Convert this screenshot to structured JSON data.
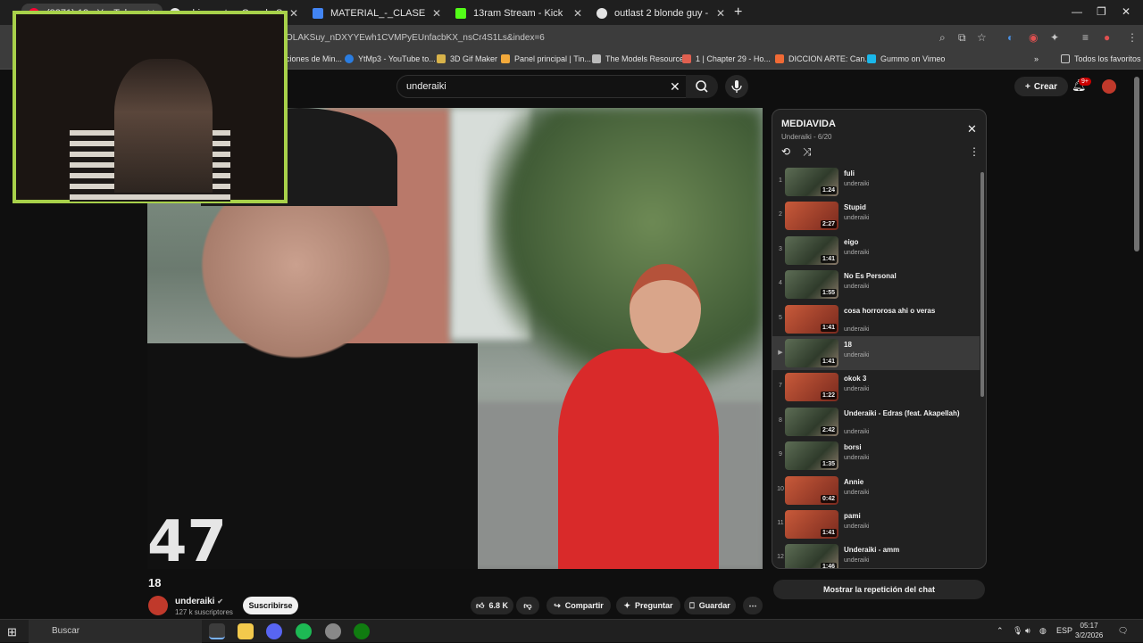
{
  "browser": {
    "tabs": [
      {
        "label": "(8271) 18 - YouTube",
        "color": "#ff0033",
        "active": true
      },
      {
        "label": "chinamate - Google Search",
        "color": "#e3e3e3",
        "active": false
      },
      {
        "label": "MATERIAL_-_CLASE_01 - Goog",
        "color": "#4285f4",
        "active": false
      },
      {
        "label": "13ram Stream - Kick Dashb",
        "color": "#53fc18",
        "active": false
      },
      {
        "label": "outlast 2 blonde guy - Google",
        "color": "#e3e3e3",
        "active": false
      }
    ],
    "url": "OLAKSuy_nDXYYEwh1CVMPyEUnfacbKX_nsCr4S1Ls&index=6",
    "bookmarks": [
      {
        "label": "ciones de Min...",
        "color": "#777"
      },
      {
        "label": "YtMp3 - YouTube to...",
        "color": "#2a7de1"
      },
      {
        "label": "3D Gif Maker",
        "color": "#d8b34a"
      },
      {
        "label": "Panel principal | Tin...",
        "color": "#f2a93b"
      },
      {
        "label": "The Models Resource",
        "color": "#bbb"
      },
      {
        "label": "1 | Chapter 29 - Ho...",
        "color": "#e06050"
      },
      {
        "label": "DICCION ARTE: Can...",
        "color": "#f06a35"
      },
      {
        "label": "Gummo on Vimeo",
        "color": "#1ab7ea"
      }
    ],
    "all_bookmarks": "Todos los favoritos"
  },
  "youtube": {
    "search_query": "underaiki",
    "create_label": "Crear",
    "notif_count": "9+",
    "video": {
      "title": "18",
      "overlay_number": "47"
    },
    "channel": {
      "name": "underaiki",
      "subscribers": "127 k suscriptores",
      "subscribe_label": "Suscribirse"
    },
    "actions": {
      "likes": "6.8 K",
      "share": "Compartir",
      "ask": "Preguntar",
      "save": "Guardar"
    },
    "playlist": {
      "title": "MEDIAVIDA",
      "subtitle": "Underaiki - 6/20",
      "items": [
        {
          "index": "1",
          "title": "fuli",
          "author": "underaiki",
          "duration": "1:24",
          "thumb": "photo"
        },
        {
          "index": "2",
          "title": "Stupid",
          "author": "underaiki",
          "duration": "2:27",
          "thumb": "logo"
        },
        {
          "index": "3",
          "title": "eigo",
          "author": "underaiki",
          "duration": "1:41",
          "thumb": "photo"
        },
        {
          "index": "4",
          "title": "No Es Personal",
          "author": "underaiki",
          "duration": "1:55",
          "thumb": "photo"
        },
        {
          "index": "5",
          "title": "cosa horrorosa ahi o veras",
          "author": "underaiki",
          "duration": "1:41",
          "thumb": "logo"
        },
        {
          "index": "▶",
          "title": "18",
          "author": "underaiki",
          "duration": "1:41",
          "thumb": "photo"
        },
        {
          "index": "7",
          "title": "okok 3",
          "author": "underaiki",
          "duration": "1:22",
          "thumb": "logo"
        },
        {
          "index": "8",
          "title": "Underaiki - Edras (feat. Akapellah)",
          "author": "underaiki",
          "duration": "2:42",
          "thumb": "photo"
        },
        {
          "index": "9",
          "title": "borsi",
          "author": "underaiki",
          "duration": "1:35",
          "thumb": "photo"
        },
        {
          "index": "10",
          "title": "Annie",
          "author": "underaiki",
          "duration": "0:42",
          "thumb": "logo"
        },
        {
          "index": "11",
          "title": "pami",
          "author": "underaiki",
          "duration": "1:41",
          "thumb": "logo"
        },
        {
          "index": "12",
          "title": "Underaiki - amm",
          "author": "underaiki",
          "duration": "1:46",
          "thumb": "photo"
        }
      ],
      "active_index": 5
    },
    "chat_replay": "Mostrar la repetición del chat"
  },
  "taskbar": {
    "search_label": "Buscar",
    "lang": "ESP",
    "time": "05:17",
    "date": "3/2/2026",
    "notif": "3"
  }
}
